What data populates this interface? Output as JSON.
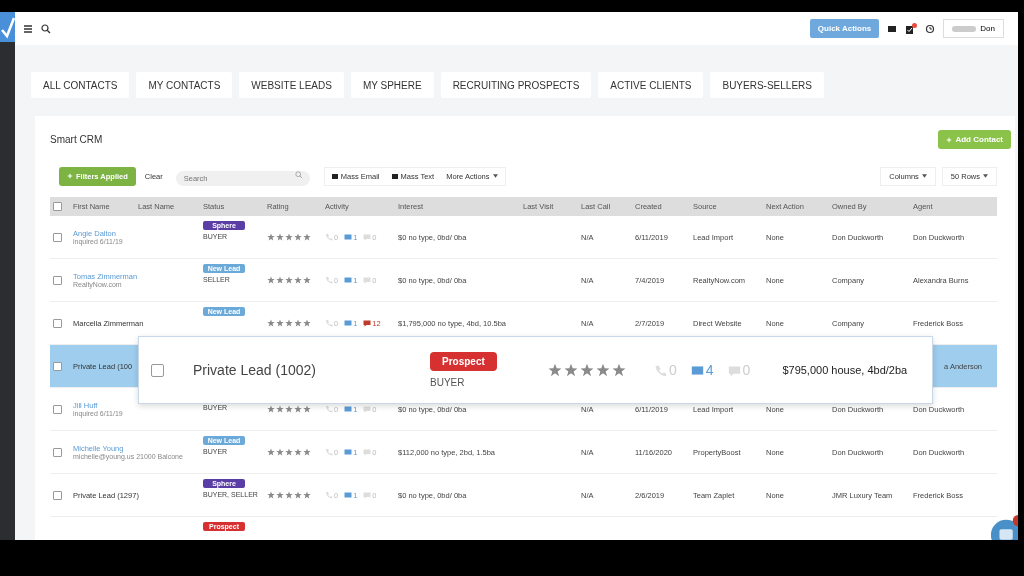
{
  "topbar": {
    "quick_actions": "Quick Actions",
    "user": "Don"
  },
  "tabs": [
    {
      "label": "ALL CONTACTS"
    },
    {
      "label": "MY CONTACTS"
    },
    {
      "label": "WEBSITE LEADS"
    },
    {
      "label": "MY SPHERE"
    },
    {
      "label": "RECRUITING PROSPECTS"
    },
    {
      "label": "ACTIVE CLIENTS"
    },
    {
      "label": "BUYERS-SELLERS"
    }
  ],
  "crm": {
    "title": "Smart CRM",
    "add_button": "Add Contact",
    "filters_button": "Filters Applied",
    "clear": "Clear",
    "search": {
      "placeholder": "Search"
    },
    "mass_email": "Mass Email",
    "mass_text": "Mass Text",
    "more_actions": "More Actions",
    "columns": "Columns",
    "rows_per_page": "50 Rows"
  },
  "table": {
    "all_checked": false,
    "columns": [
      "First Name",
      "Last Name",
      "Status",
      "Rating",
      "Activity",
      "Interest",
      "Last Visit",
      "Last Call",
      "Created",
      "Source",
      "Next Action",
      "Owned By",
      "Agent"
    ],
    "rows": [
      {
        "selected": false,
        "checked": false,
        "name": "Angie Dalton",
        "sub": "inquired 6/11/19",
        "status": {
          "label": "Sphere",
          "color": "#5a3ea6"
        },
        "role": "BUYER",
        "stars": 5,
        "activity": {
          "calls": "0",
          "emails": "1",
          "texts": "0",
          "texts_unread": false
        },
        "interest": "$0 no type, 0bd/ 0ba",
        "last_call": "N/A",
        "created": "6/11/2019",
        "source": "Lead Import",
        "next_action": "None",
        "owned_by": "Don Duckworth",
        "agent": "Don Duckworth"
      },
      {
        "selected": false,
        "checked": false,
        "name": "Tomas Zimmerman",
        "sub": "RealtyNow.com",
        "status": {
          "label": "New Lead",
          "color": "#6aa9d8"
        },
        "role": "SELLER",
        "stars": 5,
        "activity": {
          "calls": "0",
          "emails": "1",
          "texts": "0",
          "texts_unread": false
        },
        "interest": "$0 no type, 0bd/ 0ba",
        "last_call": "N/A",
        "created": "7/4/2019",
        "source": "RealtyNow.com",
        "next_action": "None",
        "owned_by": "Company",
        "agent": "Alexandra Burns"
      },
      {
        "selected": false,
        "checked": false,
        "name": "Marcella Zimmerman",
        "status": {
          "label": "New Lead",
          "color": "#6aa9d8"
        },
        "stars": 5,
        "activity": {
          "calls": "0",
          "emails": "1",
          "texts": "12",
          "texts_unread": true
        },
        "interest": "$1,795,000 no type, 4bd, 10.5ba",
        "last_call": "N/A",
        "created": "2/7/2019",
        "source": "Direct Website",
        "next_action": "None",
        "owned_by": "Company",
        "agent": "Frederick Boss"
      },
      {
        "selected": true,
        "checked": false,
        "name": "Private Lead (100",
        "agent": "a Anderson"
      },
      {
        "selected": false,
        "checked": false,
        "name": "Jill Huff",
        "sub": "inquired 6/11/19",
        "role": "BUYER",
        "stars": 5,
        "activity": {
          "calls": "0",
          "emails": "1",
          "texts": "0",
          "texts_unread": false
        },
        "interest": "$0 no type, 0bd/ 0ba",
        "last_call": "N/A",
        "created": "6/11/2019",
        "source": "Lead Import",
        "next_action": "None",
        "owned_by": "Don Duckworth",
        "agent": "Don Duckworth"
      },
      {
        "selected": false,
        "checked": false,
        "name": "Michelle Young",
        "sub": "michelle@young.us 21000 Balcone",
        "status": {
          "label": "New Lead",
          "color": "#6aa9d8"
        },
        "role": "BUYER",
        "stars": 5,
        "activity": {
          "calls": "0",
          "emails": "1",
          "texts": "0",
          "texts_unread": false
        },
        "interest": "$112,000 no type, 2bd, 1.5ba",
        "last_call": "N/A",
        "created": "11/16/2020",
        "source": "PropertyBoost",
        "next_action": "None",
        "owned_by": "Don Duckworth",
        "agent": "Don Duckworth"
      },
      {
        "selected": false,
        "checked": false,
        "name": "Private Lead (1297)",
        "status": {
          "label": "Sphere",
          "color": "#5a3ea6"
        },
        "role": "BUYER, SELLER",
        "stars": 5,
        "activity": {
          "calls": "0",
          "emails": "1",
          "texts": "0",
          "texts_unread": false
        },
        "interest": "$0 no type, 0bd/ 0ba",
        "last_call": "N/A",
        "created": "2/6/2019",
        "source": "Team Zaplet",
        "next_action": "None",
        "owned_by": "JMR Luxury Team",
        "agent": "Frederick Boss"
      },
      {
        "status": {
          "label": "Prospect",
          "color": "#d63031"
        }
      }
    ]
  },
  "popup": {
    "checked": false,
    "name": "Private Lead (1002)",
    "status": {
      "label": "Prospect",
      "color": "#d63031"
    },
    "role": "BUYER",
    "stars": 5,
    "activity": {
      "calls": "0",
      "emails": "4",
      "texts": "0"
    },
    "interest": "$795,000 house, 4bd/2ba"
  }
}
